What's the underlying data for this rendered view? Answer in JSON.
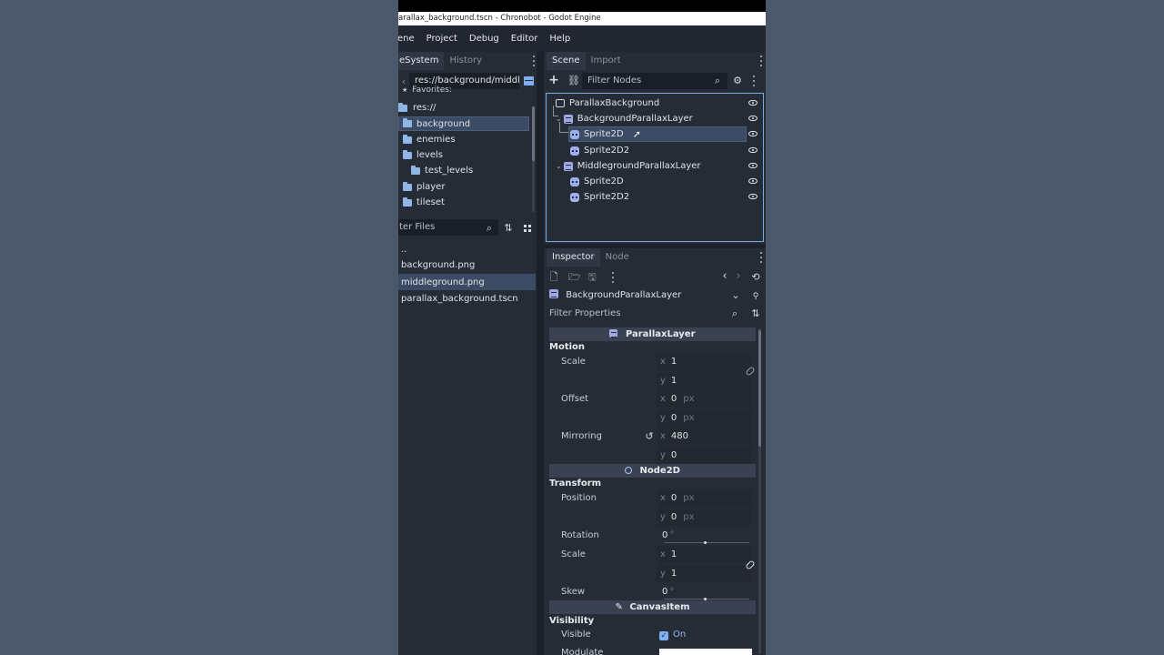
{
  "window": {
    "title": "arallax_background.tscn - Chronobot - Godot Engine"
  },
  "menu": [
    "ene",
    "Project",
    "Debug",
    "Editor",
    "Help"
  ],
  "filesystem": {
    "tabs": [
      "eSystem",
      "History"
    ],
    "path": "res://background/middle",
    "favorites": "Favorites:",
    "tree": [
      {
        "label": "res://"
      },
      {
        "label": "background"
      },
      {
        "label": "enemies"
      },
      {
        "label": "levels"
      },
      {
        "label": "test_levels"
      },
      {
        "label": "player"
      },
      {
        "label": "tileset"
      }
    ],
    "filter_placeholder": "ter Files",
    "files": [
      "..",
      "background.png",
      "middleground.png",
      "parallax_background.tscn"
    ]
  },
  "scene": {
    "tabs": [
      "Scene",
      "Import"
    ],
    "filter_placeholder": "Filter Nodes",
    "nodes": [
      {
        "label": "ParallaxBackground"
      },
      {
        "label": "BackgroundParallaxLayer"
      },
      {
        "label": "Sprite2D"
      },
      {
        "label": "Sprite2D2"
      },
      {
        "label": "MiddlegroundParallaxLayer"
      },
      {
        "label": "Sprite2D"
      },
      {
        "label": "Sprite2D2"
      }
    ]
  },
  "inspector": {
    "tabs": [
      "Inspector",
      "Node"
    ],
    "object": "BackgroundParallaxLayer",
    "filter_placeholder": "Filter Properties",
    "sections": {
      "parallax": "ParallaxLayer",
      "motion": "Motion",
      "node2d": "Node2D",
      "transform": "Transform",
      "canvasitem": "CanvasItem",
      "visibility": "Visibility"
    },
    "props": {
      "scale_label": "Scale",
      "scale_x": "1",
      "scale_y": "1",
      "offset_label": "Offset",
      "offset_x": "0",
      "offset_y": "0",
      "mirroring_label": "Mirroring",
      "mirroring_x": "480",
      "mirroring_y": "0",
      "position_label": "Position",
      "position_x": "0",
      "position_y": "0",
      "rotation_label": "Rotation",
      "rotation_value": "0",
      "t_scale_label": "Scale",
      "t_scale_x": "1",
      "t_scale_y": "1",
      "skew_label": "Skew",
      "skew_value": "0",
      "visible_label": "Visible",
      "visible_value": "On",
      "modulate_label": "Modulate"
    },
    "axis_x": "x",
    "axis_y": "y",
    "unit_px": "px",
    "unit_deg": "°"
  },
  "colors": {
    "accent": "#7fb1f0",
    "selection": "#3b4b63",
    "panel": "#262c36"
  }
}
